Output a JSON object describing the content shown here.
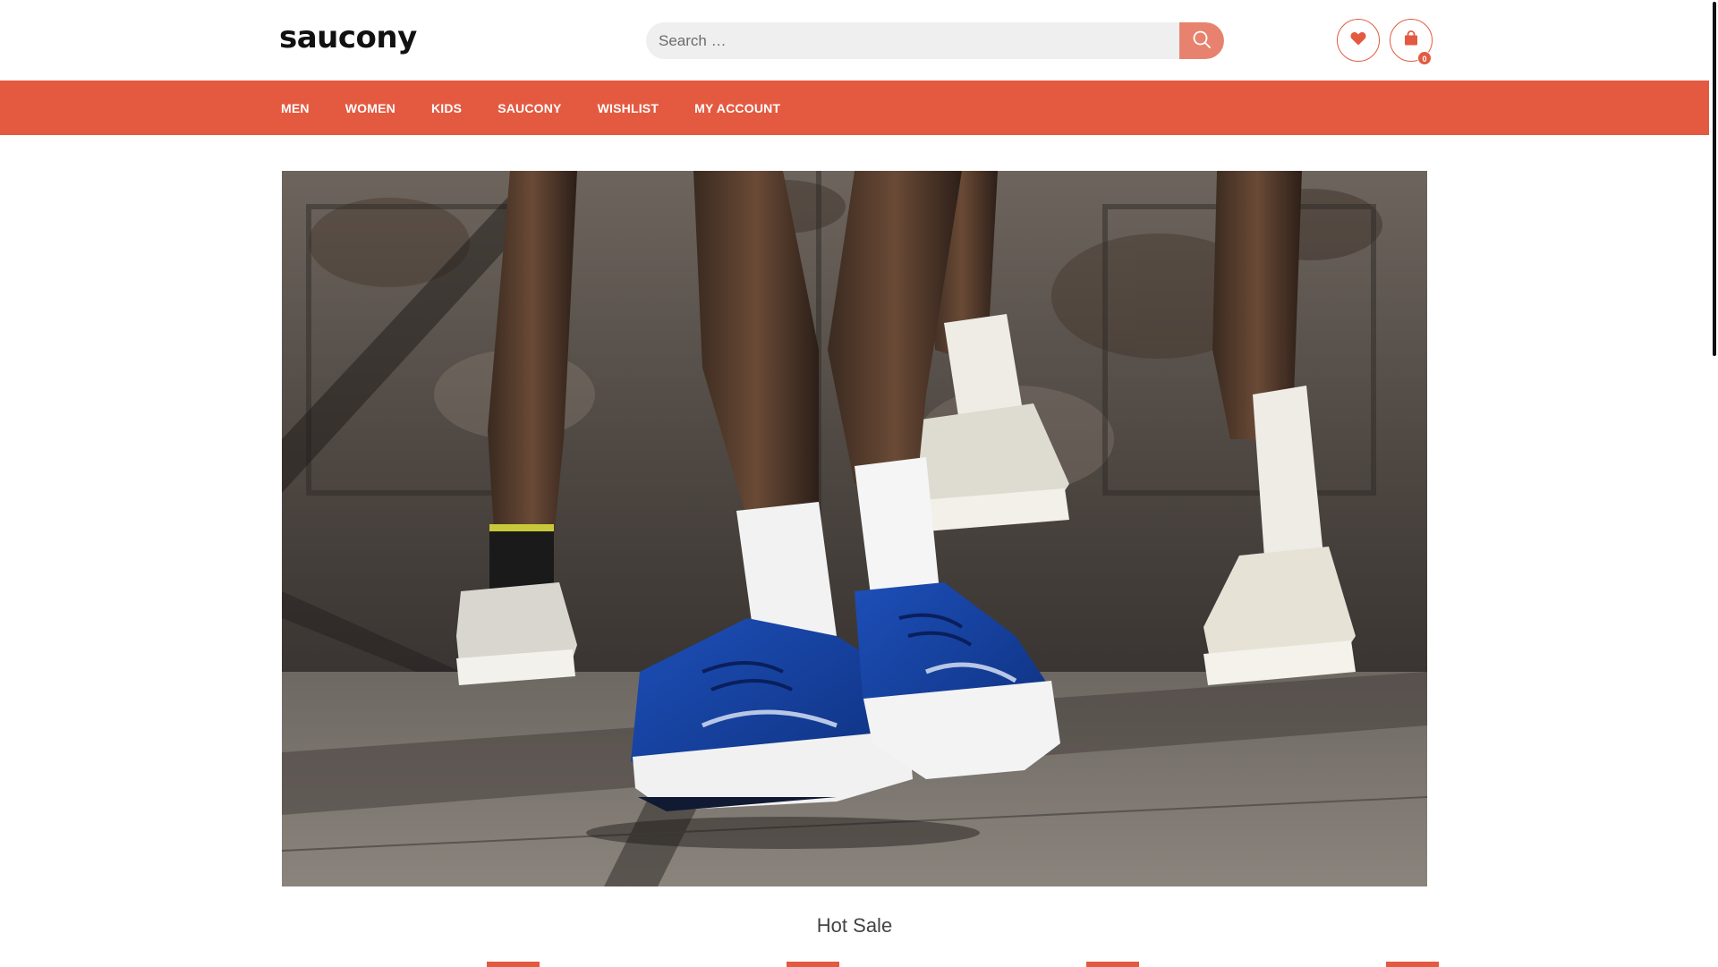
{
  "brand": {
    "logo_text": "saucony",
    "accent_color": "#e35a40"
  },
  "search": {
    "placeholder": "Search …",
    "value": "",
    "button_icon": "search-icon"
  },
  "header_actions": {
    "wishlist_icon": "heart-icon",
    "cart_icon": "shopping-bag-icon",
    "cart_count": "0"
  },
  "nav": {
    "items": [
      {
        "label": "MEN"
      },
      {
        "label": "WOMEN"
      },
      {
        "label": "KIDS"
      },
      {
        "label": "SAUCONY"
      },
      {
        "label": "WISHLIST"
      },
      {
        "label": "MY ACCOUNT"
      }
    ]
  },
  "hero": {
    "image_description": "runners-legs-saucony-shoes"
  },
  "sections": {
    "hot_sale_title": "Hot Sale"
  }
}
